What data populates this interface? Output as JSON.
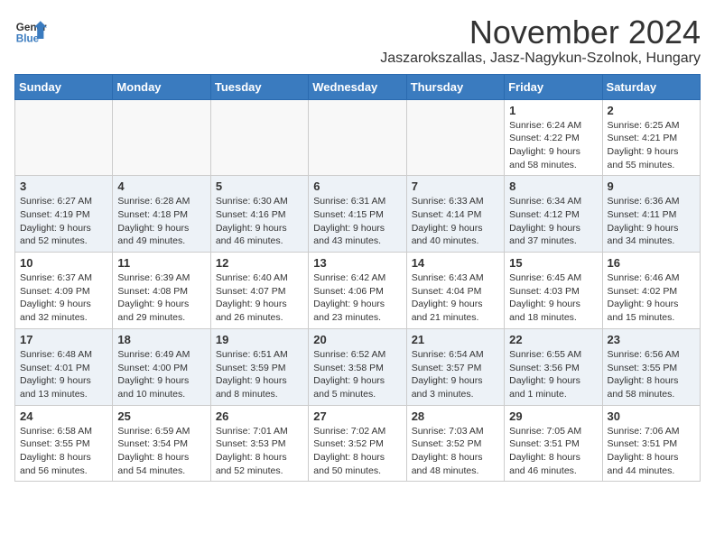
{
  "header": {
    "logo_general": "General",
    "logo_blue": "Blue",
    "title": "November 2024",
    "subtitle": "Jaszarokszallas, Jasz-Nagykun-Szolnok, Hungary"
  },
  "weekdays": [
    "Sunday",
    "Monday",
    "Tuesday",
    "Wednesday",
    "Thursday",
    "Friday",
    "Saturday"
  ],
  "weeks": [
    [
      {
        "day": "",
        "info": ""
      },
      {
        "day": "",
        "info": ""
      },
      {
        "day": "",
        "info": ""
      },
      {
        "day": "",
        "info": ""
      },
      {
        "day": "",
        "info": ""
      },
      {
        "day": "1",
        "info": "Sunrise: 6:24 AM\nSunset: 4:22 PM\nDaylight: 9 hours\nand 58 minutes."
      },
      {
        "day": "2",
        "info": "Sunrise: 6:25 AM\nSunset: 4:21 PM\nDaylight: 9 hours\nand 55 minutes."
      }
    ],
    [
      {
        "day": "3",
        "info": "Sunrise: 6:27 AM\nSunset: 4:19 PM\nDaylight: 9 hours\nand 52 minutes."
      },
      {
        "day": "4",
        "info": "Sunrise: 6:28 AM\nSunset: 4:18 PM\nDaylight: 9 hours\nand 49 minutes."
      },
      {
        "day": "5",
        "info": "Sunrise: 6:30 AM\nSunset: 4:16 PM\nDaylight: 9 hours\nand 46 minutes."
      },
      {
        "day": "6",
        "info": "Sunrise: 6:31 AM\nSunset: 4:15 PM\nDaylight: 9 hours\nand 43 minutes."
      },
      {
        "day": "7",
        "info": "Sunrise: 6:33 AM\nSunset: 4:14 PM\nDaylight: 9 hours\nand 40 minutes."
      },
      {
        "day": "8",
        "info": "Sunrise: 6:34 AM\nSunset: 4:12 PM\nDaylight: 9 hours\nand 37 minutes."
      },
      {
        "day": "9",
        "info": "Sunrise: 6:36 AM\nSunset: 4:11 PM\nDaylight: 9 hours\nand 34 minutes."
      }
    ],
    [
      {
        "day": "10",
        "info": "Sunrise: 6:37 AM\nSunset: 4:09 PM\nDaylight: 9 hours\nand 32 minutes."
      },
      {
        "day": "11",
        "info": "Sunrise: 6:39 AM\nSunset: 4:08 PM\nDaylight: 9 hours\nand 29 minutes."
      },
      {
        "day": "12",
        "info": "Sunrise: 6:40 AM\nSunset: 4:07 PM\nDaylight: 9 hours\nand 26 minutes."
      },
      {
        "day": "13",
        "info": "Sunrise: 6:42 AM\nSunset: 4:06 PM\nDaylight: 9 hours\nand 23 minutes."
      },
      {
        "day": "14",
        "info": "Sunrise: 6:43 AM\nSunset: 4:04 PM\nDaylight: 9 hours\nand 21 minutes."
      },
      {
        "day": "15",
        "info": "Sunrise: 6:45 AM\nSunset: 4:03 PM\nDaylight: 9 hours\nand 18 minutes."
      },
      {
        "day": "16",
        "info": "Sunrise: 6:46 AM\nSunset: 4:02 PM\nDaylight: 9 hours\nand 15 minutes."
      }
    ],
    [
      {
        "day": "17",
        "info": "Sunrise: 6:48 AM\nSunset: 4:01 PM\nDaylight: 9 hours\nand 13 minutes."
      },
      {
        "day": "18",
        "info": "Sunrise: 6:49 AM\nSunset: 4:00 PM\nDaylight: 9 hours\nand 10 minutes."
      },
      {
        "day": "19",
        "info": "Sunrise: 6:51 AM\nSunset: 3:59 PM\nDaylight: 9 hours\nand 8 minutes."
      },
      {
        "day": "20",
        "info": "Sunrise: 6:52 AM\nSunset: 3:58 PM\nDaylight: 9 hours\nand 5 minutes."
      },
      {
        "day": "21",
        "info": "Sunrise: 6:54 AM\nSunset: 3:57 PM\nDaylight: 9 hours\nand 3 minutes."
      },
      {
        "day": "22",
        "info": "Sunrise: 6:55 AM\nSunset: 3:56 PM\nDaylight: 9 hours\nand 1 minute."
      },
      {
        "day": "23",
        "info": "Sunrise: 6:56 AM\nSunset: 3:55 PM\nDaylight: 8 hours\nand 58 minutes."
      }
    ],
    [
      {
        "day": "24",
        "info": "Sunrise: 6:58 AM\nSunset: 3:55 PM\nDaylight: 8 hours\nand 56 minutes."
      },
      {
        "day": "25",
        "info": "Sunrise: 6:59 AM\nSunset: 3:54 PM\nDaylight: 8 hours\nand 54 minutes."
      },
      {
        "day": "26",
        "info": "Sunrise: 7:01 AM\nSunset: 3:53 PM\nDaylight: 8 hours\nand 52 minutes."
      },
      {
        "day": "27",
        "info": "Sunrise: 7:02 AM\nSunset: 3:52 PM\nDaylight: 8 hours\nand 50 minutes."
      },
      {
        "day": "28",
        "info": "Sunrise: 7:03 AM\nSunset: 3:52 PM\nDaylight: 8 hours\nand 48 minutes."
      },
      {
        "day": "29",
        "info": "Sunrise: 7:05 AM\nSunset: 3:51 PM\nDaylight: 8 hours\nand 46 minutes."
      },
      {
        "day": "30",
        "info": "Sunrise: 7:06 AM\nSunset: 3:51 PM\nDaylight: 8 hours\nand 44 minutes."
      }
    ]
  ]
}
